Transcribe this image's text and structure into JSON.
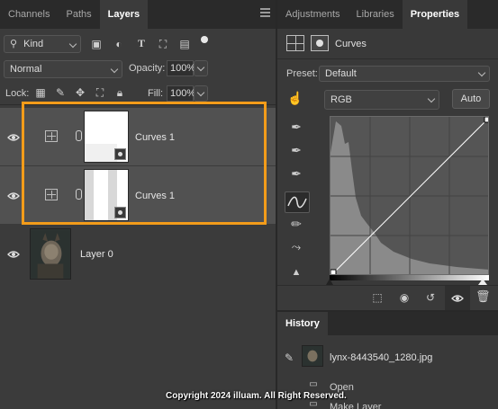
{
  "layers_panel": {
    "tabs": [
      "Channels",
      "Paths",
      "Layers"
    ],
    "active_tab": "Layers",
    "filter": {
      "label": "Kind"
    },
    "blend_mode": "Normal",
    "opacity_label": "Opacity:",
    "opacity_value": "100%",
    "lock_label": "Lock:",
    "fill_label": "Fill:",
    "fill_value": "100%",
    "layers": [
      {
        "name": "Curves 1",
        "type": "adjustment",
        "visible": true,
        "selected": true
      },
      {
        "name": "Curves 1",
        "type": "adjustment",
        "visible": true,
        "selected": true
      },
      {
        "name": "Layer 0",
        "type": "image",
        "visible": true,
        "selected": false
      }
    ]
  },
  "properties_panel": {
    "tabs": [
      "Adjustments",
      "Libraries",
      "Properties"
    ],
    "active_tab": "Properties",
    "title": "Curves",
    "preset_label": "Preset:",
    "preset_value": "Default",
    "channel_value": "RGB",
    "auto_label": "Auto"
  },
  "history_panel": {
    "tab": "History",
    "snapshot_name": "lynx-8443540_1280.jpg",
    "items": [
      "Open",
      "Make Layer"
    ]
  },
  "watermark": "Copyright 2024 illuam. All Right Reserved.",
  "colors": {
    "highlight": "#f39c1a",
    "panel_bg": "#393939",
    "tab_bar_bg": "#2a2a2a"
  }
}
